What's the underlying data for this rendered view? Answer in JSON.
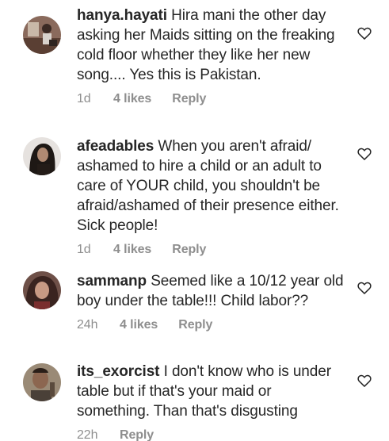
{
  "comments": [
    {
      "username": "hanya.hayati",
      "text": "Hira mani the other day asking her Maids sitting on the freaking cold floor whether they like her new song.... Yes this is Pakistan.",
      "time": "1d",
      "likes": "4 likes",
      "reply": "Reply"
    },
    {
      "username": "afeadables",
      "text": "When you aren't afraid/ ashamed to hire a child or an adult to care of YOUR child, you shouldn't be afraid/ashamed of their presence either. Sick people!",
      "time": "1d",
      "likes": "4 likes",
      "reply": "Reply"
    },
    {
      "username": "sammanp",
      "text": "Seemed like a 10/12 year old boy under the table!!! Child labor??",
      "time": "24h",
      "likes": "4 likes",
      "reply": "Reply"
    },
    {
      "username": "its_exorcist",
      "text": "I don't know who is under table but if that's your maid or something. Than that's disgusting",
      "time": "22h",
      "likes": "",
      "reply": "Reply"
    }
  ],
  "icons": {
    "like": "heart-outline-icon",
    "avatar": "profile-avatar"
  },
  "colors": {
    "text": "#262626",
    "meta": "#8e8e8e"
  }
}
